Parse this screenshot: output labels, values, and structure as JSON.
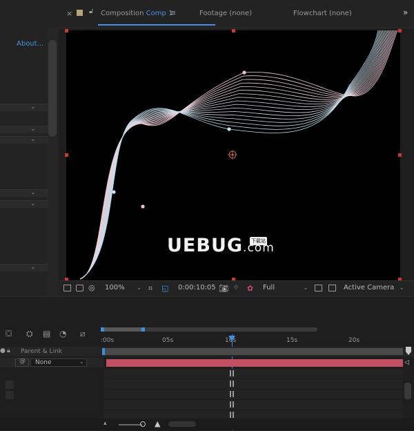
{
  "left_panel": {
    "about_link": "About..."
  },
  "header": {
    "tabs": [
      {
        "prefix": "Composition",
        "name": "Comp 1"
      },
      {
        "label": "Footage  (none)"
      },
      {
        "label": "Flowchart  (none)"
      }
    ]
  },
  "viewer_toolbar": {
    "zoom": "100%",
    "timecode": "0:00:10:05",
    "resolution": "Full",
    "camera": "Active Camera"
  },
  "timeline": {
    "parent_header": "Parent & Link",
    "parent_value": "None",
    "ruler_labels": [
      ":00s",
      "05s",
      "10s",
      "15s",
      "20s"
    ],
    "current_label": "10s"
  },
  "watermark": {
    "text": "UEBUG",
    "suffix": ".com",
    "badge": "下载站"
  }
}
